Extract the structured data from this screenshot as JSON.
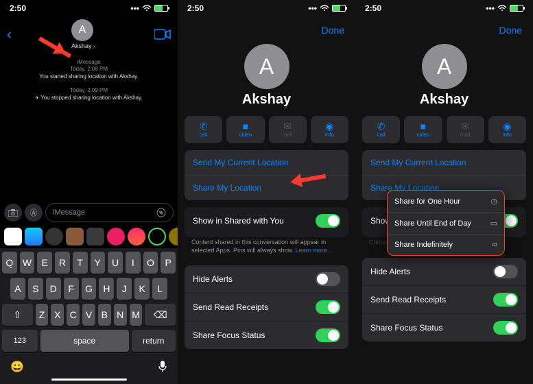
{
  "status": {
    "time": "2:50"
  },
  "screen1": {
    "contactLetter": "A",
    "contactName": "Akshay",
    "sys1_app": "iMessage",
    "sys1_time": "Today, 2:08 PM",
    "sys1_msg": "You started sharing location with Akshay.",
    "sys2_time": "Today, 2:09 PM",
    "sys2_msg": "You stopped sharing location with Akshay.",
    "placeholder": "iMessage",
    "keys_r1": [
      "Q",
      "W",
      "E",
      "R",
      "T",
      "Y",
      "U",
      "I",
      "O",
      "P"
    ],
    "keys_r2": [
      "A",
      "S",
      "D",
      "F",
      "G",
      "H",
      "J",
      "K",
      "L"
    ],
    "keys_r3": [
      "Z",
      "X",
      "C",
      "V",
      "B",
      "N",
      "M"
    ],
    "key_123": "123",
    "key_space": "space",
    "key_return": "return"
  },
  "detail": {
    "done": "Done",
    "avatarLetter": "A",
    "name": "Akshay",
    "actions": {
      "call": "call",
      "video": "video",
      "mail": "mail",
      "info": "info"
    },
    "links": {
      "sendLoc": "Send My Current Location",
      "shareLoc": "Share My Location"
    },
    "shared": "Show in Shared with You",
    "hint": "Content shared in this conversation will appear in selected Apps. Pins will always show.",
    "learn": "Learn more…",
    "rows": {
      "hide": "Hide Alerts",
      "read": "Send Read Receipts",
      "focus": "Share Focus Status"
    }
  },
  "s3": {
    "showPartial": "Show",
    "menu": {
      "hour": "Share for One Hour",
      "eod": "Share Until End of Day",
      "indef": "Share Indefinitely"
    }
  }
}
